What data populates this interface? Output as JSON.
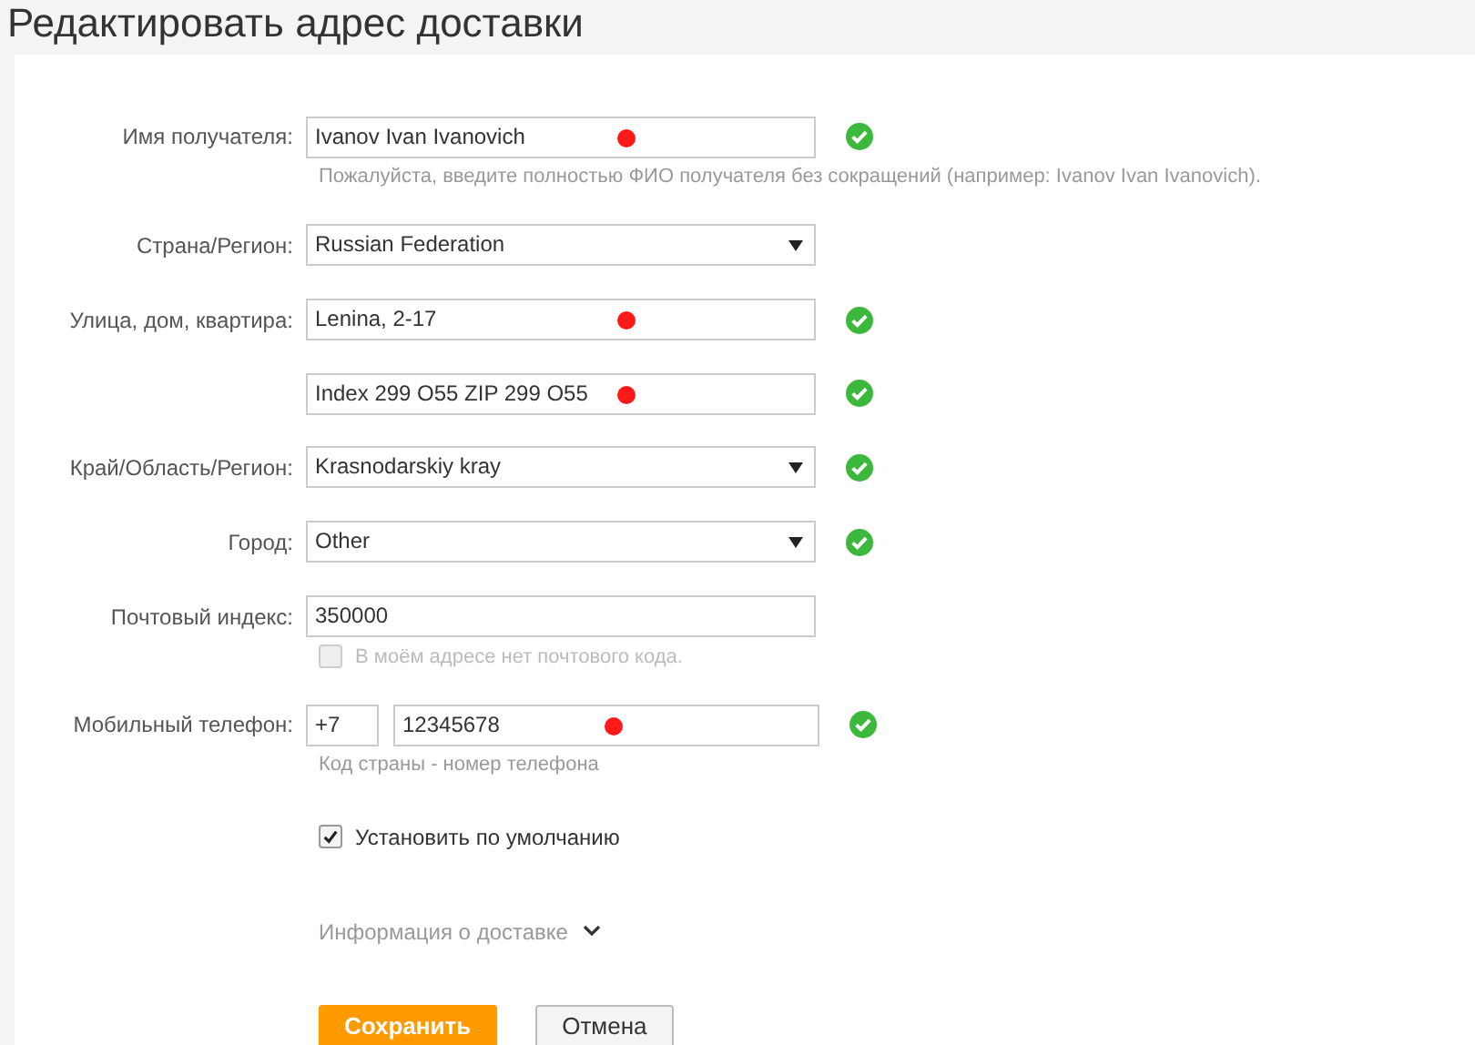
{
  "title": "Редактировать адрес доставки",
  "fields": [
    {
      "kind": "text",
      "label": "Имя получателя:",
      "value": "Ivanov Ivan Ivanovich",
      "valid": true,
      "marked": true,
      "hint": "Пожалуйста, введите полностью ФИО получателя без сокращений (например: Ivanov Ivan Ivanovich)."
    },
    {
      "kind": "select",
      "label": "Страна/Регион:",
      "value": "Russian Federation",
      "valid": false,
      "marked": false
    },
    {
      "kind": "text",
      "label": "Улица, дом, квартира:",
      "value": "Lenina, 2-17",
      "valid": true,
      "marked": true
    },
    {
      "kind": "text",
      "value": "Index 299 O55 ZIP 299 O55",
      "valid": true,
      "marked": true
    },
    {
      "kind": "select",
      "label": "Край/Область/Регион:",
      "value": "Krasnodarskiy kray",
      "valid": true,
      "marked": false
    },
    {
      "kind": "select",
      "label": "Город:",
      "value": "Other",
      "valid": true,
      "marked": false
    },
    {
      "kind": "text",
      "label": "Почтовый индекс:",
      "value": "350000",
      "valid": false,
      "marked": false,
      "option": {
        "label": "В моём адресе нет почтового кода.",
        "checked": false,
        "disabled": true
      }
    },
    {
      "kind": "phone",
      "label": "Мобильный телефон:",
      "code": "+7",
      "value": "12345678",
      "valid": true,
      "marked": true,
      "hint": "Код страны - номер телефона"
    }
  ],
  "default_option": {
    "label": "Установить по умолчанию",
    "checked": true
  },
  "delivery_info": {
    "label": "Информация о доставке",
    "expanded": false
  },
  "buttons": [
    {
      "kind": "primary",
      "label": "Сохранить"
    },
    {
      "kind": "secondary",
      "label": "Отмена"
    }
  ]
}
